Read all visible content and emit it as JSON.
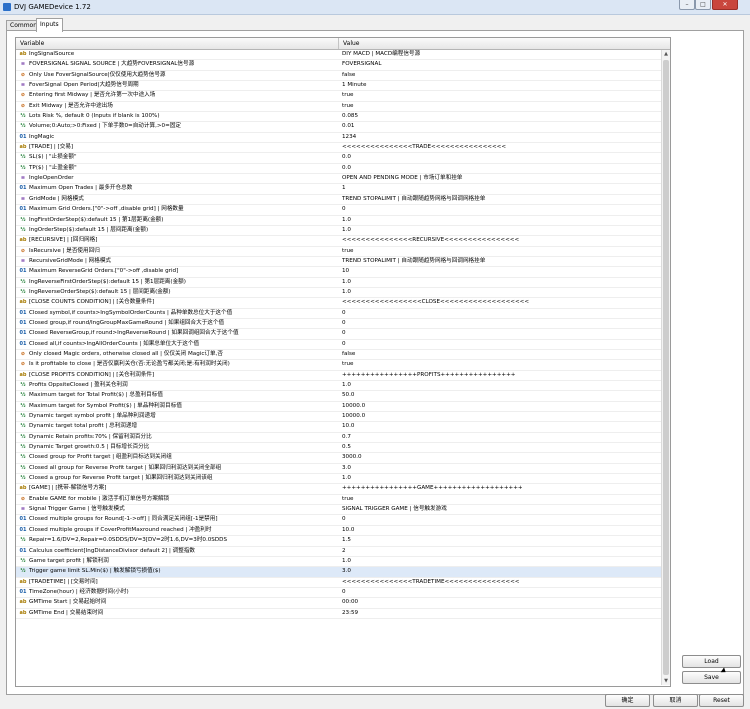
{
  "window": {
    "title": "DVJ GAMEDevice 1.72",
    "minimize": "–",
    "maximize": "□",
    "close": "✕"
  },
  "tabs": [
    {
      "label": "Common"
    },
    {
      "label": "Inputs"
    }
  ],
  "grid": {
    "col_variable": "Variable",
    "col_value": "Value",
    "rows": [
      {
        "type": "str",
        "icon": "string-icon",
        "name": "IngSignalSource",
        "value": "DIY MACD | MACD编程信号源"
      },
      {
        "type": "enum",
        "icon": "enum-icon",
        "name": "FOVERSIGNAL SIGNAL SOURCE | 大趋势FOVERSIGNAL信号源",
        "value": "FOVERSIGNAL"
      },
      {
        "type": "bool",
        "icon": "bool-icon",
        "name": "Only Use FoverSignalSource|仅仅使用大趋势信号源",
        "value": "false"
      },
      {
        "type": "enum",
        "icon": "enum-icon",
        "name": "FoverSignal Open Period|大趋势信号周期",
        "value": "1 Minute"
      },
      {
        "type": "bool",
        "icon": "bool-icon",
        "name": "Entering first Midway | 是否允许第一次中途入场",
        "value": "true"
      },
      {
        "type": "bool",
        "icon": "bool-icon",
        "name": "Exit Midway | 是否允许中途出场",
        "value": "true"
      },
      {
        "type": "dbl",
        "icon": "double-icon",
        "name": "Lots Risk %, default 0 (Inputs if blank is 100%)",
        "value": "0.085"
      },
      {
        "type": "dbl",
        "icon": "double-icon",
        "name": "Volume;0:Auto;>0:Fixed | 下单手数0=自动计算,>0=固定",
        "value": "0.01"
      },
      {
        "type": "int",
        "icon": "int-icon",
        "name": "IngMagic",
        "value": "1234"
      },
      {
        "type": "str",
        "icon": "string-icon",
        "name": "[TRADE] | [交易]",
        "value": "<<<<<<<<<<<<<<<TRADE<<<<<<<<<<<<<<<<"
      },
      {
        "type": "dbl",
        "icon": "double-icon",
        "name": "SL($) | \"止损金额\"",
        "value": "0.0"
      },
      {
        "type": "dbl",
        "icon": "double-icon",
        "name": "TP($) | \"止盈金额\"",
        "value": "0.0"
      },
      {
        "type": "enum",
        "icon": "enum-icon",
        "name": "IngleOpenOrder",
        "value": "OPEN AND PENDING MODE | 市场订单和挂单"
      },
      {
        "type": "int",
        "icon": "int-icon",
        "name": "Maximum Open Trades | 最多开仓总数",
        "value": "1"
      },
      {
        "type": "enum",
        "icon": "enum-icon",
        "name": "GridMode | 网格模式",
        "value": "TREND STOPALIMIT | 自动跟随趋势网格与回调网格挂单"
      },
      {
        "type": "int",
        "icon": "int-icon",
        "name": "Maximum Grid Orders.[\"0\"->off ,disable grid] | 网格数量",
        "value": "0"
      },
      {
        "type": "dbl",
        "icon": "double-icon",
        "name": "IngFirstOrderStep($):default 15 | 第1层距离(金额)",
        "value": "1.0"
      },
      {
        "type": "dbl",
        "icon": "double-icon",
        "name": "IngOrderStep($):default 15 | 层间距离(金额)",
        "value": "1.0"
      },
      {
        "type": "str",
        "icon": "string-icon",
        "name": "[RECURSIVE] | [回归网格]",
        "value": "<<<<<<<<<<<<<<<RECURSIVE<<<<<<<<<<<<<<<<"
      },
      {
        "type": "bool",
        "icon": "bool-icon",
        "name": "IsRecursive | 是否使用回归",
        "value": "true"
      },
      {
        "type": "enum",
        "icon": "enum-icon",
        "name": "RecursiveGridMode | 网格模式",
        "value": "TREND STOPALIMIT | 自动跟随趋势网格与回调网格挂单"
      },
      {
        "type": "int",
        "icon": "int-icon",
        "name": "Maximum ReverseGrid Orders.[\"0\"->off ,disable grid]",
        "value": "10"
      },
      {
        "type": "dbl",
        "icon": "double-icon",
        "name": "IngReverseFirstOrderStep($):default 15 | 第1层距离(金额)",
        "value": "1.0"
      },
      {
        "type": "dbl",
        "icon": "double-icon",
        "name": "IngReverseOrderStep($):default 15 | 层间距离(金额)",
        "value": "1.0"
      },
      {
        "type": "str",
        "icon": "string-icon",
        "name": "[CLOSE COUNTS CONDITION] | [关仓数量条件]",
        "value": "<<<<<<<<<<<<<<<<<CLOSE<<<<<<<<<<<<<<<<<<<"
      },
      {
        "type": "int",
        "icon": "int-icon",
        "name": "Closed symbol,if counts>IngSymbolOrderCounts | 品种单数总位大于这个值",
        "value": "0"
      },
      {
        "type": "int",
        "icon": "int-icon",
        "name": "Closed group,if round/IngGroupMaxGameRound | 如果组回合大于这个值",
        "value": "0"
      },
      {
        "type": "int",
        "icon": "int-icon",
        "name": "Closed ReverseGroup,if round>IngReverseRound | 如果回调组回合大于这个值",
        "value": "0"
      },
      {
        "type": "int",
        "icon": "int-icon",
        "name": "Closed all,if counts>IngAllOrderCounts | 如果总单位大于这个值",
        "value": "0"
      },
      {
        "type": "bool",
        "icon": "bool-icon",
        "name": "Only closed Magic orders, otherwise closed all | 仅仅关闭 Magic订单,否",
        "value": "false"
      },
      {
        "type": "bool",
        "icon": "bool-icon",
        "name": "Is it profitable to close | 是否仅赢利关仓(否:无论盈亏都关闭;是:有利润时关闭)",
        "value": "true"
      },
      {
        "type": "str",
        "icon": "string-icon",
        "name": "[CLOSE PROFITS CONDITION] | [关仓利润条件]",
        "value": "++++++++++++++++PROFITS++++++++++++++++"
      },
      {
        "type": "dbl",
        "icon": "double-icon",
        "name": "Profits OppsiteClosed | 盈利关仓利润",
        "value": "1.0"
      },
      {
        "type": "dbl",
        "icon": "double-icon",
        "name": "Maximum target for Total Profit($) | 总盈利目标值",
        "value": "50.0"
      },
      {
        "type": "dbl",
        "icon": "double-icon",
        "name": "Maximum target for Symbol Profit($) | 单品种利润目标值",
        "value": "10000.0"
      },
      {
        "type": "dbl",
        "icon": "double-icon",
        "name": "Dynamic target symbol profit | 单品种利润递增",
        "value": "10000.0"
      },
      {
        "type": "dbl",
        "icon": "double-icon",
        "name": "Dynamic target total profit | 总利润递增",
        "value": "10.0"
      },
      {
        "type": "dbl",
        "icon": "double-icon",
        "name": "Dynamic Retain profits:70% | 保留利润百分比",
        "value": "0.7"
      },
      {
        "type": "dbl",
        "icon": "double-icon",
        "name": "Dynamic Target growth:0.5 | 目标增长百分比",
        "value": "0.5"
      },
      {
        "type": "dbl",
        "icon": "double-icon",
        "name": "Closed group for Profit target | 组盈利目标达到关闭组",
        "value": "3000.0"
      },
      {
        "type": "dbl",
        "icon": "double-icon",
        "name": "Closed all group for Reverse Profit target | 如果回归利润达到关闭全部组",
        "value": "3.0"
      },
      {
        "type": "dbl",
        "icon": "double-icon",
        "name": "Closed a group for Reverse Profit target | 如果回归利润达到关闭该组",
        "value": "1.0"
      },
      {
        "type": "str",
        "icon": "string-icon",
        "name": "[GAME] | [携带-解锁信号方案]",
        "value": "++++++++++++++++GAME+++++++++++++++++++"
      },
      {
        "type": "bool",
        "icon": "bool-icon",
        "name": "Enable GAME for mobile | 激活手机订单信号方案解锁",
        "value": "true"
      },
      {
        "type": "enum",
        "icon": "enum-icon",
        "name": "Signal Trigger Game | 信号触发模式",
        "value": "SIGNAL TRIGGER GAME | 信号触发游戏"
      },
      {
        "type": "int",
        "icon": "int-icon",
        "name": "Closed multiple groups for Round[-1->off] | 同合满足关闭组[-1是禁用]",
        "value": "0"
      },
      {
        "type": "int",
        "icon": "int-icon",
        "name": "Closed multiple groups if CoverProfitMaxround reached | 冲盈利时",
        "value": "10.0"
      },
      {
        "type": "dbl",
        "icon": "double-icon",
        "name": "Repair=1.6/DV=2,Repair=0.0SDDS/DV=3[DV=2时1.6,DV=3时0.0SDDS",
        "value": "1.5"
      },
      {
        "type": "int",
        "icon": "int-icon",
        "name": "Calculus coefficient[IngDistanceDivisor default 2] | 调整指数",
        "value": "2"
      },
      {
        "type": "dbl",
        "icon": "double-icon",
        "name": "Game target profit | 解锁利润",
        "value": "1.0"
      },
      {
        "type": "dbl",
        "icon": "double-icon",
        "name": "Trigger game limit SL.Min($) | 触发解锁亏损值($)",
        "value": "3.0"
      },
      {
        "type": "str",
        "icon": "string-icon",
        "name": "[TRADETIME] | [交易时间]",
        "value": "<<<<<<<<<<<<<<<TRADETIME<<<<<<<<<<<<<<<<"
      },
      {
        "type": "int",
        "icon": "int-icon",
        "name": "TimeZone(hour) | 经济数据时间(小时)",
        "value": "0"
      },
      {
        "type": "str",
        "icon": "string-icon",
        "name": "GMTime Start | 交易起始时间",
        "value": "00:00"
      },
      {
        "type": "str",
        "icon": "string-icon",
        "name": "GMTime End | 交易结束时间",
        "value": "23:59"
      }
    ]
  },
  "side_buttons": {
    "load": "Load",
    "save": "Save"
  },
  "buttons": {
    "ok": "确定",
    "cancel": "取消",
    "reset": "Reset"
  },
  "selected_row_index": 50
}
